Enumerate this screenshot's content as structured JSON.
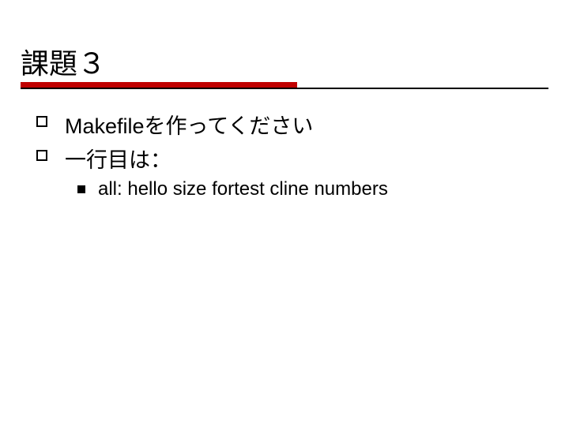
{
  "title": "課題３",
  "bullets": {
    "item1": "Makefileを作ってください",
    "item2": "一行目は：",
    "sub1": "all: hello size fortest cline numbers"
  }
}
